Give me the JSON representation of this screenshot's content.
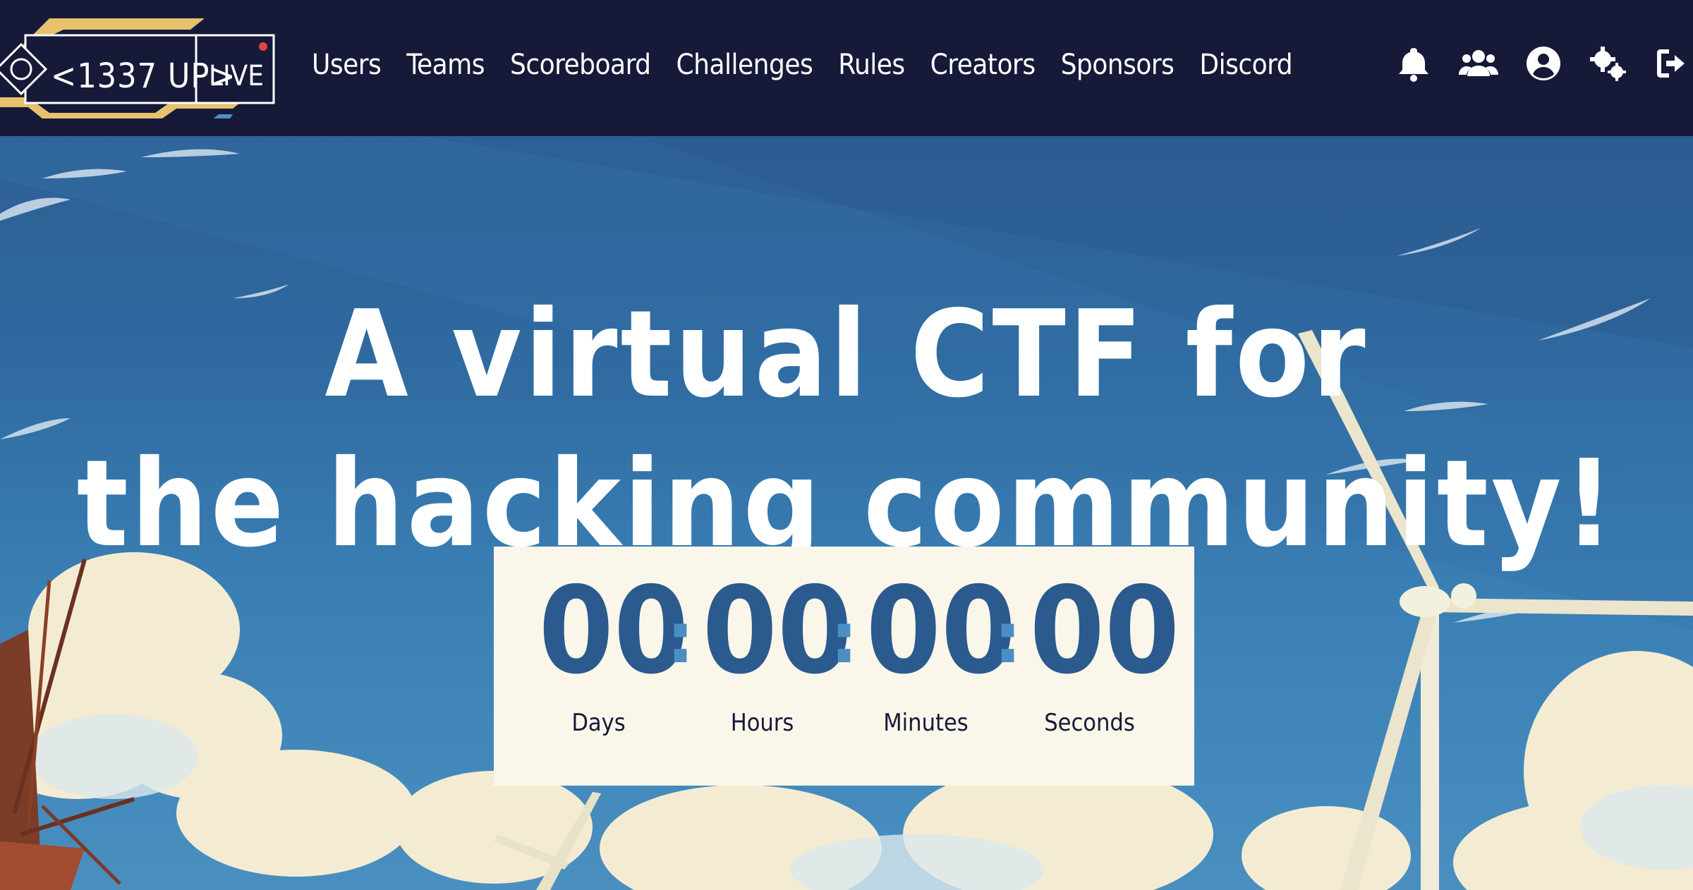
{
  "brand": {
    "name": "<1337 UP>",
    "live": "LIVE",
    "colors": {
      "gold": "#e7c16c",
      "blue": "#4e8fc8",
      "live_dot": "#e0463f"
    }
  },
  "nav": {
    "links": [
      "Users",
      "Teams",
      "Scoreboard",
      "Challenges",
      "Rules",
      "Creators",
      "Sponsors",
      "Discord"
    ],
    "icons": [
      "bell-icon",
      "users-icon",
      "user-circle-icon",
      "settings-icon",
      "logout-icon"
    ]
  },
  "hero": {
    "title_line1": "A virtual CTF for",
    "title_line2": "the hacking community!"
  },
  "countdown": {
    "days": "00",
    "hours": "00",
    "minutes": "00",
    "seconds": "00",
    "separator": ":",
    "labels": {
      "days": "Days",
      "hours": "Hours",
      "minutes": "Minutes",
      "seconds": "Seconds"
    }
  },
  "colors": {
    "navbar_bg": "#161a38",
    "countdown_bg": "#faf6ea",
    "countdown_digits": "#2a5a8e",
    "countdown_separator": "#4b8ec4"
  }
}
